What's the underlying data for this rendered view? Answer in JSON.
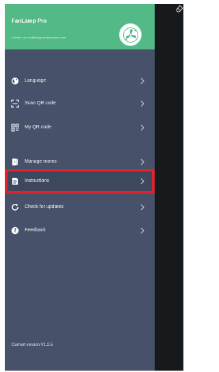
{
  "header": {
    "app_title": "FanLamp Pro",
    "account_email": "Contact: du.cnd@lengyuandecoration.com"
  },
  "menu": {
    "items": [
      {
        "label": "Language",
        "icon": "globe-icon"
      },
      {
        "label": "Scan QR code",
        "icon": "scan-icon"
      },
      {
        "label": "My QR code",
        "icon": "qr-code-icon"
      },
      {
        "label": "Manage rooms",
        "icon": "door-icon"
      },
      {
        "label": "Instructions",
        "icon": "document-icon"
      },
      {
        "label": "Check for updates",
        "icon": "refresh-icon"
      },
      {
        "label": "Feedback",
        "icon": "help-icon"
      }
    ],
    "highlighted_item": "Instructions"
  },
  "footer": {
    "version_text": "Current version V1.2.5"
  },
  "colors": {
    "drawer_background": "#47526a",
    "header_green": "#53b987",
    "highlight_red": "#e0222e",
    "backdrop": "#161a1d"
  }
}
